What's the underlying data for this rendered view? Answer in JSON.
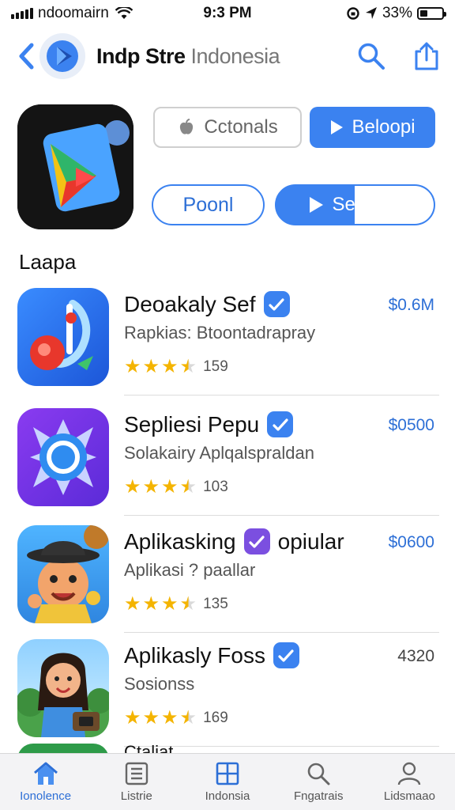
{
  "status_bar": {
    "carrier": "ndoomairn",
    "time": "9:3 PM",
    "battery": "33%",
    "battery_level": 0.33
  },
  "nav": {
    "title_main": "Indp Stre",
    "title_sub": "Indonesia"
  },
  "featured": {
    "button_top_left": "Cctonals",
    "button_top_right": "Beloopi",
    "button_bottom_left": "Poonl",
    "button_bottom_right": "Seldoan"
  },
  "section": {
    "title": "Laapa"
  },
  "apps": [
    {
      "name": "Deoakaly Sef",
      "desc": "Rapkias: Btoontadrapray",
      "count": "159",
      "price": "$0.6M",
      "rating": 3.5,
      "badge": "blue"
    },
    {
      "name": "Sepliesi Pepu",
      "desc": "Solakairy Aplqalspraldan",
      "count": "103",
      "price": "$0500",
      "rating": 3.5,
      "badge": "blue"
    },
    {
      "name": "Aplikasking",
      "name_suffix": "opiular",
      "desc": "Aplikasi ? paallar",
      "count": "135",
      "price": "$0600",
      "rating": 3.5,
      "badge": "purple"
    },
    {
      "name": "Aplikasly Foss",
      "desc": "Sosionss",
      "count": "169",
      "price": "4320",
      "rating": 3.5,
      "badge": "blue"
    }
  ],
  "partial_row": {
    "text": "Ctaliat"
  },
  "tabs": [
    {
      "label": "Ionolence",
      "icon": "home-icon",
      "active": true
    },
    {
      "label": "Listrie",
      "icon": "list-icon",
      "active": false
    },
    {
      "label": "Indonsia",
      "icon": "grid-icon",
      "active": false
    },
    {
      "label": "Fngatrais",
      "icon": "search-icon",
      "active": false
    },
    {
      "label": "Lidsmaao",
      "icon": "person-icon",
      "active": false
    }
  ],
  "colors": {
    "accent": "#3b82f0",
    "star": "#f4b400",
    "purple_badge": "#7b4fe0"
  }
}
